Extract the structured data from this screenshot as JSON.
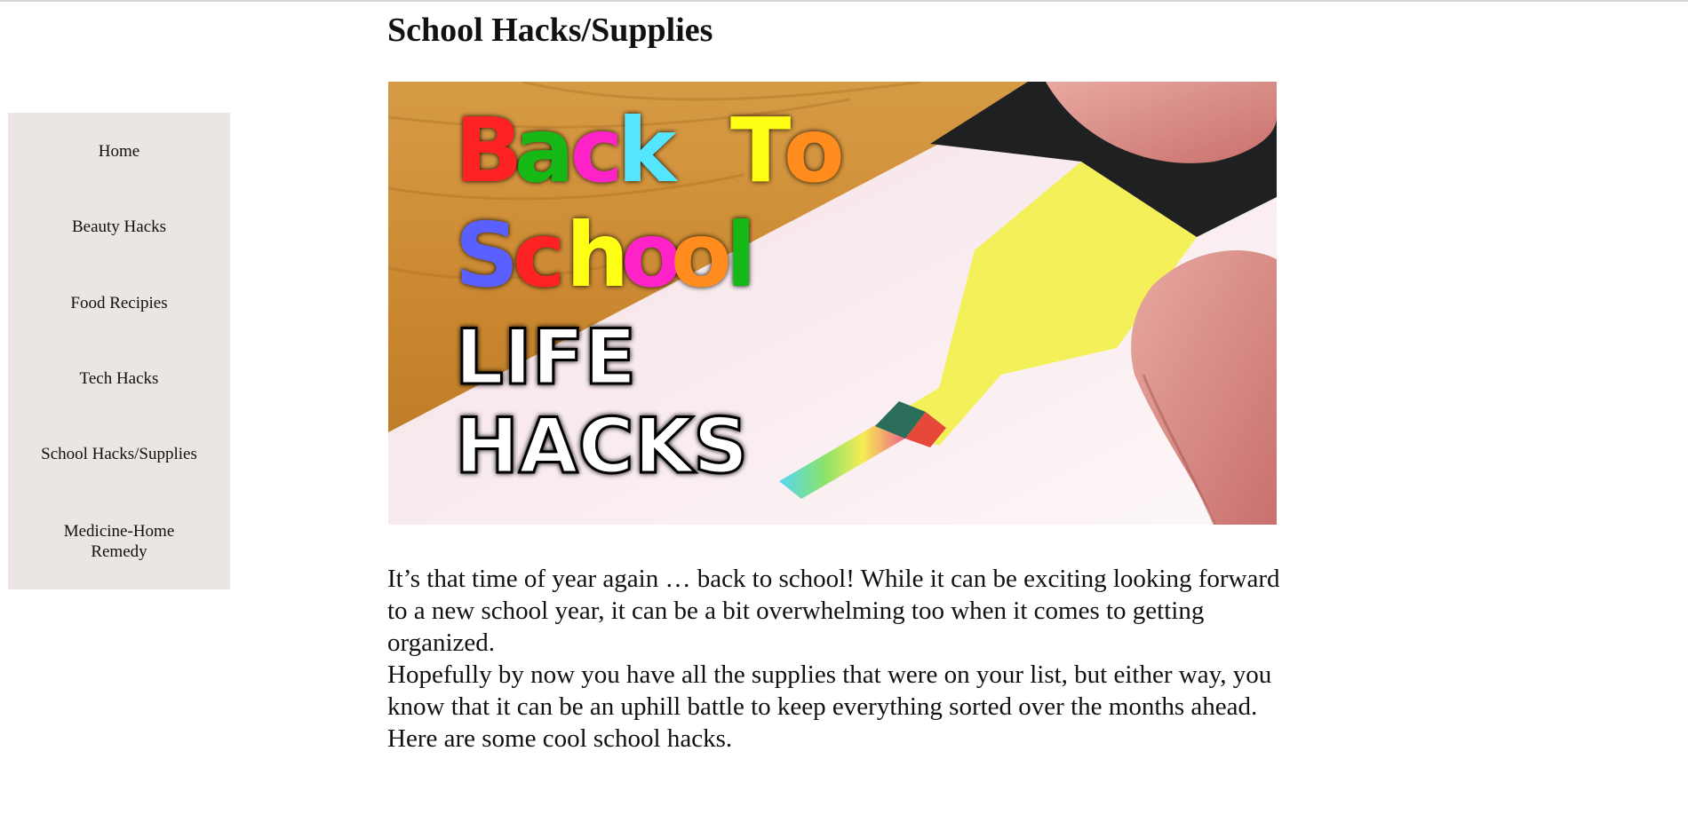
{
  "page": {
    "title": "School Hacks/Supplies"
  },
  "sidebar": {
    "items": [
      {
        "label": "Home"
      },
      {
        "label": "Beauty Hacks"
      },
      {
        "label": "Food Recipies"
      },
      {
        "label": "Tech Hacks"
      },
      {
        "label": "School Hacks/Supplies"
      },
      {
        "label": "Medicine-Home Remedy"
      }
    ]
  },
  "hero": {
    "line1": [
      "B",
      "a",
      "c",
      "k",
      "T",
      "o"
    ],
    "line2": [
      "S",
      "c",
      "h",
      "o",
      "o",
      "l"
    ],
    "line3": "LIFE",
    "line4": "HACKS"
  },
  "article": {
    "paragraphs": [
      "It’s that time of year again … back to school! While it can be exciting looking forward to a new school year, it can be a bit overwhelming too when it comes to getting organized.",
      "Hopefully by now you have all the supplies that were on your list, but either way, you know that it can be an uphill battle to keep everything sorted over the months ahead.",
      "Here are some cool school hacks."
    ]
  },
  "colors": {
    "sidebar_bg": "#ebe5e3",
    "highlighter": "#f4f05a",
    "letters": [
      "#ff2020",
      "#15b815",
      "#ff24c8",
      "#54e6ff",
      "#ffff14",
      "#ff8c1a"
    ]
  }
}
